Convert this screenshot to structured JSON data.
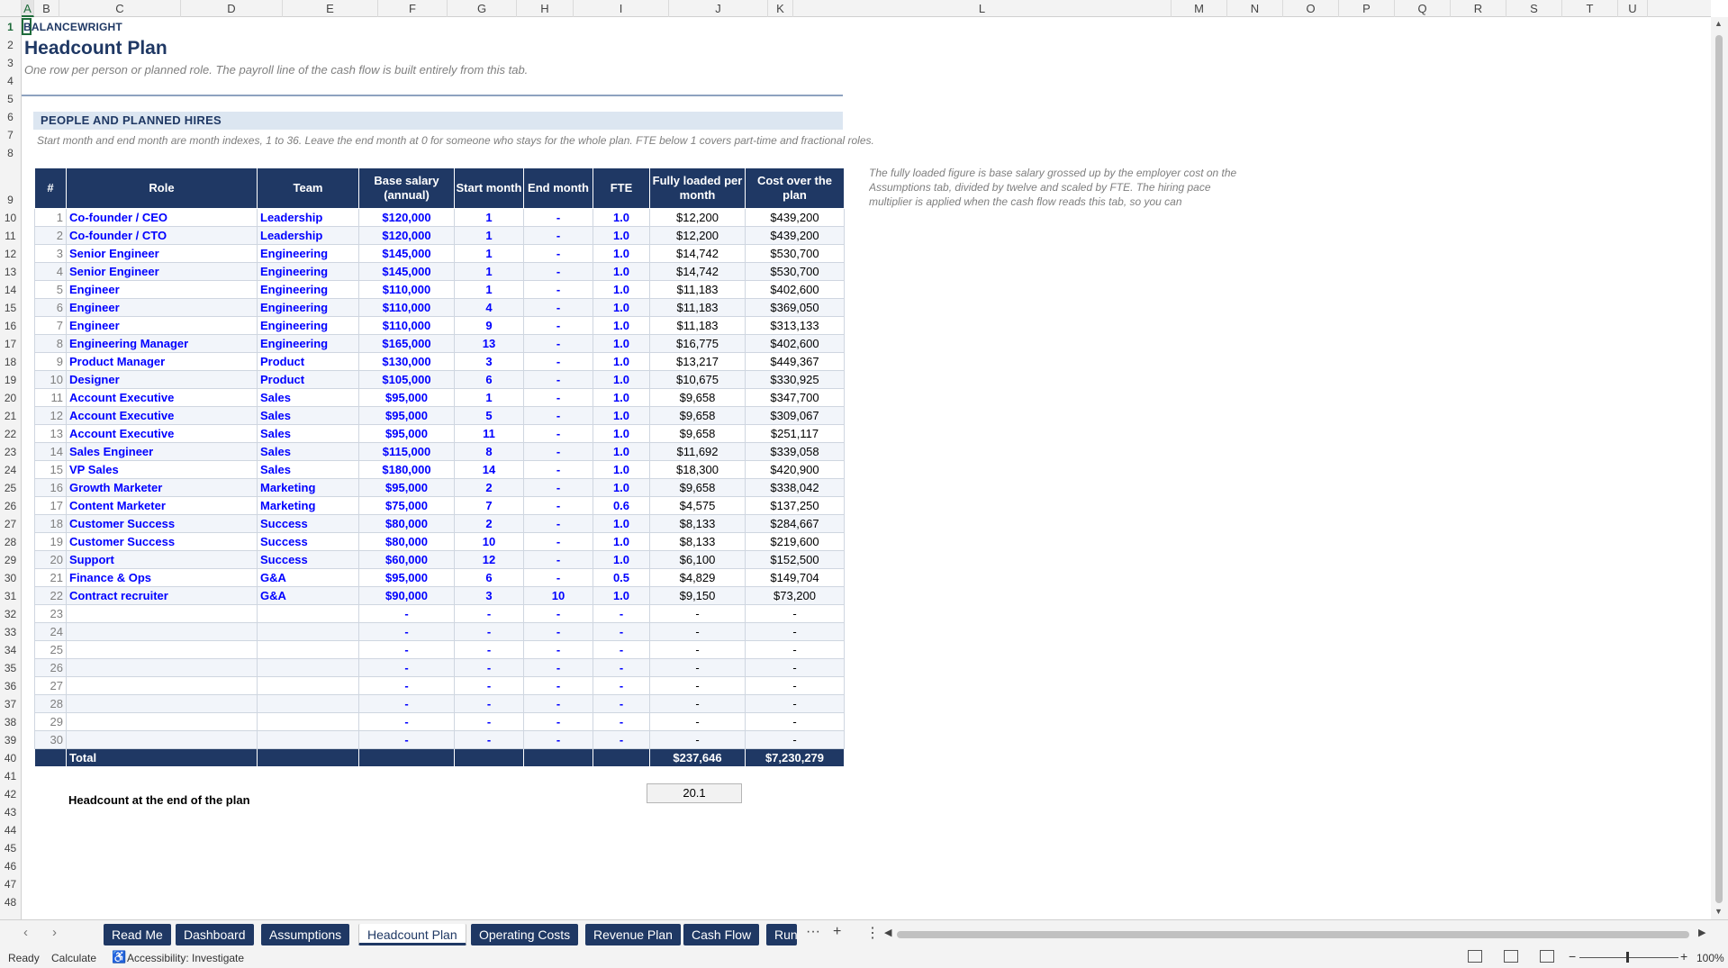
{
  "columns": [
    "A",
    "B",
    "C",
    "D",
    "E",
    "F",
    "G",
    "H",
    "I",
    "J",
    "K",
    "L",
    "M",
    "N",
    "O",
    "P",
    "Q",
    "R",
    "S",
    "T",
    "U"
  ],
  "rows": [
    "1",
    "2",
    "3",
    "4",
    "5",
    "6",
    "7",
    "8",
    "9",
    "10",
    "11",
    "12",
    "13",
    "14",
    "15",
    "16",
    "17",
    "18",
    "19",
    "20",
    "21",
    "22",
    "23",
    "24",
    "25",
    "26",
    "27",
    "28",
    "29",
    "30",
    "31",
    "32",
    "33",
    "34",
    "35",
    "36",
    "37",
    "38",
    "39",
    "40",
    "41",
    "42",
    "43",
    "44",
    "45",
    "46",
    "47",
    "48"
  ],
  "brand": "BALANCEWRIGHT",
  "title": "Headcount Plan",
  "subtitle": "One row per person or planned role. The payroll line of the cash flow is built entirely from this tab.",
  "section_title": "PEOPLE AND PLANNED HIRES",
  "section_note": "Start month and end month are month indexes, 1 to 36. Leave the end month at 0 for someone who stays for the whole plan. FTE below 1 covers part-time and fractional roles.",
  "side_note": "The fully loaded figure is base salary grossed up by the employer cost on the Assumptions tab, divided by twelve and scaled by FTE. The hiring pace multiplier is applied when the cash flow reads this tab, so you can",
  "table": {
    "headers": [
      "#",
      "Role",
      "Team",
      "Base salary (annual)",
      "Start month",
      "End month",
      "FTE",
      "Fully loaded per month",
      "Cost over the plan"
    ],
    "rows": [
      [
        "1",
        "Co-founder / CEO",
        "Leadership",
        "$120,000",
        "1",
        "-",
        "1.0",
        "$12,200",
        "$439,200"
      ],
      [
        "2",
        "Co-founder / CTO",
        "Leadership",
        "$120,000",
        "1",
        "-",
        "1.0",
        "$12,200",
        "$439,200"
      ],
      [
        "3",
        "Senior Engineer",
        "Engineering",
        "$145,000",
        "1",
        "-",
        "1.0",
        "$14,742",
        "$530,700"
      ],
      [
        "4",
        "Senior Engineer",
        "Engineering",
        "$145,000",
        "1",
        "-",
        "1.0",
        "$14,742",
        "$530,700"
      ],
      [
        "5",
        "Engineer",
        "Engineering",
        "$110,000",
        "1",
        "-",
        "1.0",
        "$11,183",
        "$402,600"
      ],
      [
        "6",
        "Engineer",
        "Engineering",
        "$110,000",
        "4",
        "-",
        "1.0",
        "$11,183",
        "$369,050"
      ],
      [
        "7",
        "Engineer",
        "Engineering",
        "$110,000",
        "9",
        "-",
        "1.0",
        "$11,183",
        "$313,133"
      ],
      [
        "8",
        "Engineering Manager",
        "Engineering",
        "$165,000",
        "13",
        "-",
        "1.0",
        "$16,775",
        "$402,600"
      ],
      [
        "9",
        "Product Manager",
        "Product",
        "$130,000",
        "3",
        "-",
        "1.0",
        "$13,217",
        "$449,367"
      ],
      [
        "10",
        "Designer",
        "Product",
        "$105,000",
        "6",
        "-",
        "1.0",
        "$10,675",
        "$330,925"
      ],
      [
        "11",
        "Account Executive",
        "Sales",
        "$95,000",
        "1",
        "-",
        "1.0",
        "$9,658",
        "$347,700"
      ],
      [
        "12",
        "Account Executive",
        "Sales",
        "$95,000",
        "5",
        "-",
        "1.0",
        "$9,658",
        "$309,067"
      ],
      [
        "13",
        "Account Executive",
        "Sales",
        "$95,000",
        "11",
        "-",
        "1.0",
        "$9,658",
        "$251,117"
      ],
      [
        "14",
        "Sales Engineer",
        "Sales",
        "$115,000",
        "8",
        "-",
        "1.0",
        "$11,692",
        "$339,058"
      ],
      [
        "15",
        "VP Sales",
        "Sales",
        "$180,000",
        "14",
        "-",
        "1.0",
        "$18,300",
        "$420,900"
      ],
      [
        "16",
        "Growth Marketer",
        "Marketing",
        "$95,000",
        "2",
        "-",
        "1.0",
        "$9,658",
        "$338,042"
      ],
      [
        "17",
        "Content Marketer",
        "Marketing",
        "$75,000",
        "7",
        "-",
        "0.6",
        "$4,575",
        "$137,250"
      ],
      [
        "18",
        "Customer Success",
        "Success",
        "$80,000",
        "2",
        "-",
        "1.0",
        "$8,133",
        "$284,667"
      ],
      [
        "19",
        "Customer Success",
        "Success",
        "$80,000",
        "10",
        "-",
        "1.0",
        "$8,133",
        "$219,600"
      ],
      [
        "20",
        "Support",
        "Success",
        "$60,000",
        "12",
        "-",
        "1.0",
        "$6,100",
        "$152,500"
      ],
      [
        "21",
        "Finance & Ops",
        "G&A",
        "$95,000",
        "6",
        "-",
        "0.5",
        "$4,829",
        "$149,704"
      ],
      [
        "22",
        "Contract recruiter",
        "G&A",
        "$90,000",
        "3",
        "10",
        "1.0",
        "$9,150",
        "$73,200"
      ],
      [
        "23",
        "",
        "",
        "-",
        "-",
        "-",
        "-",
        "-",
        "-"
      ],
      [
        "24",
        "",
        "",
        "-",
        "-",
        "-",
        "-",
        "-",
        "-"
      ],
      [
        "25",
        "",
        "",
        "-",
        "-",
        "-",
        "-",
        "-",
        "-"
      ],
      [
        "26",
        "",
        "",
        "-",
        "-",
        "-",
        "-",
        "-",
        "-"
      ],
      [
        "27",
        "",
        "",
        "-",
        "-",
        "-",
        "-",
        "-",
        "-"
      ],
      [
        "28",
        "",
        "",
        "-",
        "-",
        "-",
        "-",
        "-",
        "-"
      ],
      [
        "29",
        "",
        "",
        "-",
        "-",
        "-",
        "-",
        "-",
        "-"
      ],
      [
        "30",
        "",
        "",
        "-",
        "-",
        "-",
        "-",
        "-",
        "-"
      ]
    ],
    "total": [
      "",
      "Total",
      "",
      "",
      "",
      "",
      "",
      "$237,646",
      "$7,230,279"
    ]
  },
  "headcount_label": "Headcount at the end of the plan",
  "headcount_value": "20.1",
  "tabs": [
    "Read Me",
    "Dashboard",
    "Assumptions",
    "Headcount Plan",
    "Operating Costs",
    "Revenue Plan",
    "Cash Flow",
    "Run"
  ],
  "active_tab": "Headcount Plan",
  "status": {
    "ready": "Ready",
    "calculate": "Calculate",
    "accessibility": "Accessibility: Investigate",
    "zoom": "100%"
  }
}
